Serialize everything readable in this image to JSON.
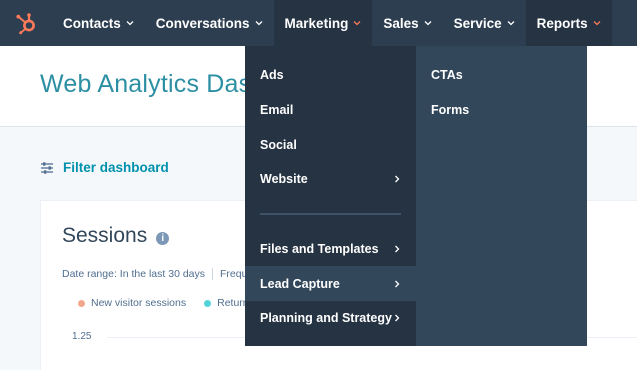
{
  "nav": {
    "items": [
      {
        "label": "Contacts",
        "active": false,
        "chevron_color": "#ffffff"
      },
      {
        "label": "Conversations",
        "active": false,
        "chevron_color": "#ffffff"
      },
      {
        "label": "Marketing",
        "active": true,
        "chevron_color": "#ff7a59"
      },
      {
        "label": "Sales",
        "active": false,
        "chevron_color": "#ffffff"
      },
      {
        "label": "Service",
        "active": false,
        "chevron_color": "#ffffff"
      },
      {
        "label": "Reports",
        "active": true,
        "chevron_color": "#ff7a59"
      }
    ]
  },
  "header": {
    "title": "Web Analytics Dashboard"
  },
  "filter": {
    "label": "Filter dashboard"
  },
  "card": {
    "title": "Sessions",
    "info_icon": "i",
    "date_range": "Date range: In the last 30 days",
    "frequency": "Frequency: Daily",
    "legend": [
      {
        "label": "New visitor sessions",
        "color": "#f2a68b"
      },
      {
        "label": "Returning visitor sessions",
        "color": "#51d3d9"
      }
    ],
    "y_tick": "1.25"
  },
  "marketing_menu": {
    "items": [
      {
        "label": "Ads",
        "has_submenu": false
      },
      {
        "label": "Email",
        "has_submenu": false
      },
      {
        "label": "Social",
        "has_submenu": false
      },
      {
        "label": "Website",
        "has_submenu": true
      }
    ],
    "items_after_divider": [
      {
        "label": "Files and Templates",
        "has_submenu": true,
        "hover": false
      },
      {
        "label": "Lead Capture",
        "has_submenu": true,
        "hover": true
      },
      {
        "label": "Planning and Strategy",
        "has_submenu": true,
        "hover": false
      }
    ],
    "submenu": [
      {
        "label": "CTAs"
      },
      {
        "label": "Forms"
      }
    ]
  },
  "colors": {
    "nav_bg": "#2d3e50",
    "accent": "#ff7a59",
    "title_teal": "#2d8fa3",
    "link": "#0091ae"
  }
}
